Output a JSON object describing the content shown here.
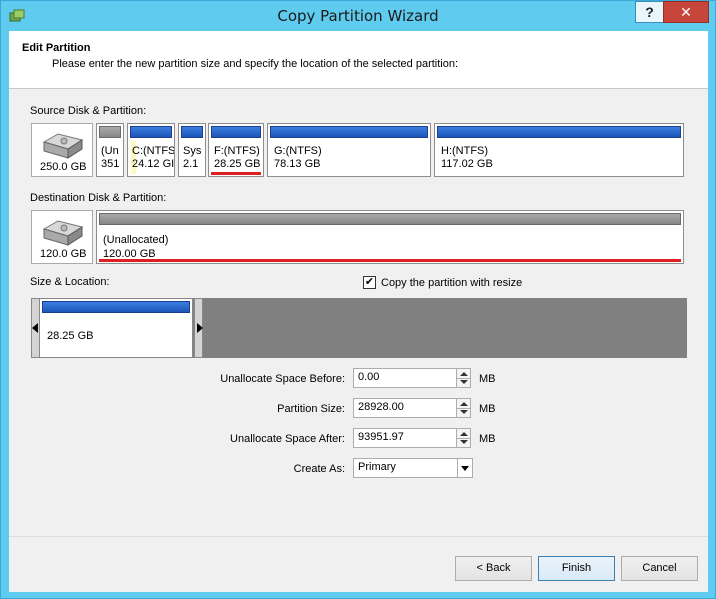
{
  "window": {
    "title": "Copy Partition Wizard",
    "help_label": "?",
    "close_label": "✕"
  },
  "header": {
    "title": "Edit Partition",
    "subtitle": "Please enter the new partition size and specify the location of the selected partition:"
  },
  "source": {
    "label": "Source Disk & Partition:",
    "disk_size": "250.0 GB",
    "partitions": [
      {
        "line1": "(Un",
        "line2": "351"
      },
      {
        "line1": "C:(NTFS",
        "line2": "24.12 GI"
      },
      {
        "line1": "Sys",
        "line2": "2.1"
      },
      {
        "line1": "F:(NTFS)",
        "line2": "28.25 GB",
        "selected": true
      },
      {
        "line1": "G:(NTFS)",
        "line2": "78.13 GB"
      },
      {
        "line1": "H:(NTFS)",
        "line2": "117.02 GB"
      }
    ]
  },
  "destination": {
    "label": "Destination Disk & Partition:",
    "disk_size": "120.0 GB",
    "partition": {
      "line1": "(Unallocated)",
      "line2": "120.00 GB"
    }
  },
  "size_location": {
    "label": "Size & Location:",
    "copy_with_resize_label": "Copy the partition with resize",
    "copy_with_resize_checked": true,
    "block_size": "28.25 GB"
  },
  "fields": {
    "before": {
      "label": "Unallocate Space Before:",
      "value": "0.00",
      "unit": "MB"
    },
    "size": {
      "label": "Partition Size:",
      "value": "28928.00",
      "unit": "MB"
    },
    "after": {
      "label": "Unallocate Space After:",
      "value": "93951.97",
      "unit": "MB"
    },
    "create_as": {
      "label": "Create As:",
      "value": "Primary"
    }
  },
  "buttons": {
    "back": "< Back",
    "finish": "Finish",
    "cancel": "Cancel"
  },
  "icons": {
    "app": "partition-wizard-icon",
    "disk": "hard-disk-icon"
  },
  "colors": {
    "title_bar": "#5fcbee",
    "partition_bar": "#1d55b8",
    "selection": "#e02020"
  }
}
